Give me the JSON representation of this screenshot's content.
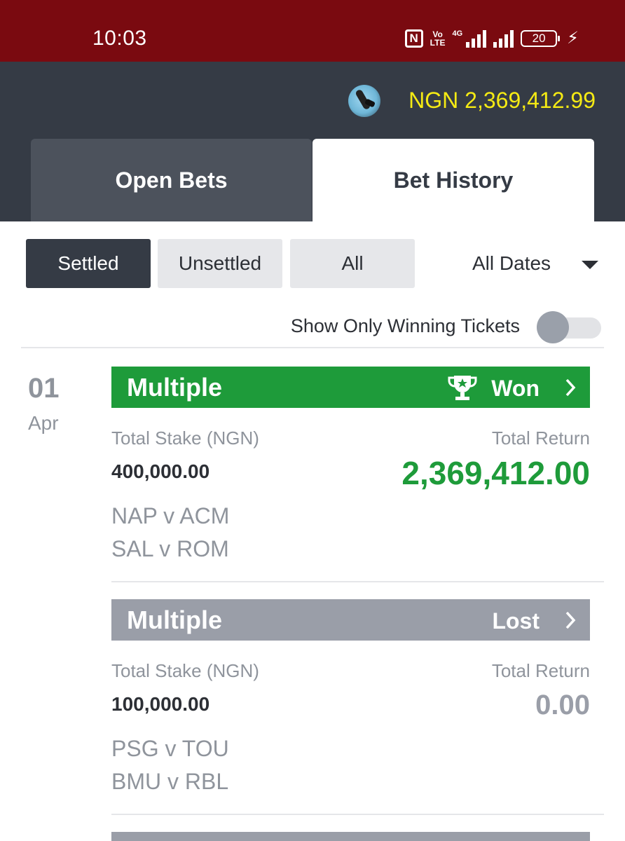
{
  "status_bar": {
    "time": "10:03",
    "volte": "Vo\nLTE",
    "network": "4G",
    "battery": "20",
    "icons": [
      "nfc-icon",
      "volte-icon",
      "signal-icon",
      "battery-icon",
      "charging-icon"
    ]
  },
  "header": {
    "balance": "NGN 2,369,412.99",
    "tabs": [
      {
        "label": "Open Bets",
        "active": false
      },
      {
        "label": "Bet History",
        "active": true
      }
    ]
  },
  "filters": {
    "buttons": [
      {
        "label": "Settled",
        "active": true
      },
      {
        "label": "Unsettled",
        "active": false
      },
      {
        "label": "All",
        "active": false
      }
    ],
    "dates": "All Dates",
    "toggle_label": "Show Only Winning Tickets",
    "toggle_on": false
  },
  "group": {
    "day": "01",
    "month": "Apr",
    "bets": [
      {
        "type": "Multiple",
        "status": "Won",
        "stake_label": "Total Stake (NGN)",
        "stake": "400,000.00",
        "return_label": "Total Return",
        "return": "2,369,412.00",
        "matches": [
          "NAP v ACM",
          "SAL v ROM"
        ]
      },
      {
        "type": "Multiple",
        "status": "Lost",
        "stake_label": "Total Stake (NGN)",
        "stake": "100,000.00",
        "return_label": "Total Return",
        "return": "0.00",
        "matches": [
          "PSG v TOU",
          "BMU v RBL"
        ]
      }
    ]
  },
  "colors": {
    "status_bar": "#7a0a10",
    "header": "#353b45",
    "balance": "#f5ea14",
    "won": "#1e9b3a",
    "lost": "#9a9ea8"
  }
}
